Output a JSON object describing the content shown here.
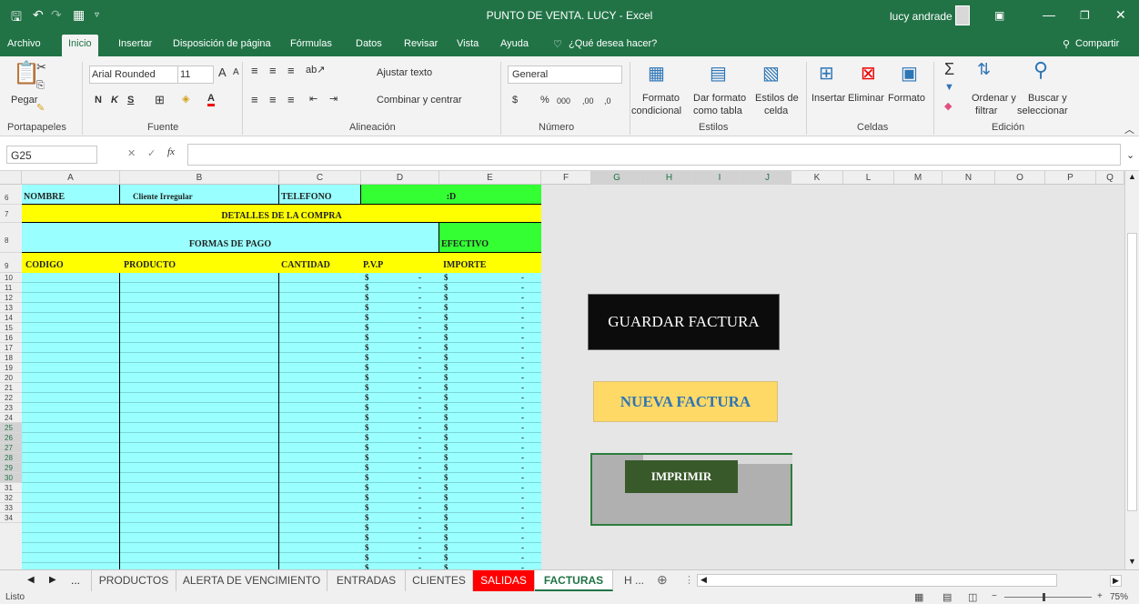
{
  "window": {
    "title": "PUNTO DE VENTA. LUCY  -  Excel",
    "user": "lucy andrade"
  },
  "menu": {
    "tabs": [
      "Archivo",
      "Inicio",
      "Insertar",
      "Disposición de página",
      "Fórmulas",
      "Datos",
      "Revisar",
      "Vista",
      "Ayuda"
    ],
    "tell_me": "¿Qué desea hacer?",
    "share": "Compartir"
  },
  "ribbon": {
    "paste": "Pegar",
    "font_name": "Arial Rounded",
    "font_size": "11",
    "font_increase": "A",
    "font_decrease": "A",
    "bold": "N",
    "italic": "K",
    "underline": "S",
    "font_color": "A",
    "wrap_text": "Ajustar texto",
    "merge_center": "Combinar y centrar",
    "number_format": "General",
    "currency": "$",
    "percent": "%",
    "thousands": "000",
    "dec_inc": ",00",
    "dec_dec": ",0",
    "cond_format": [
      "Formato",
      "condicional"
    ],
    "table_format": [
      "Dar formato",
      "como tabla"
    ],
    "cell_styles": [
      "Estilos de",
      "celda"
    ],
    "insert": "Insertar",
    "delete": "Eliminar",
    "format": "Formato",
    "sum": "Σ",
    "sort": [
      "Ordenar y",
      "filtrar"
    ],
    "find": [
      "Buscar y",
      "seleccionar"
    ],
    "groups": [
      "Portapapeles",
      "Fuente",
      "Alineación",
      "Número",
      "Estilos",
      "Celdas",
      "Edición"
    ]
  },
  "formula_bar": {
    "name_box": "G25",
    "fx": "fx",
    "value": ""
  },
  "columns": [
    "A",
    "B",
    "C",
    "D",
    "E",
    "F",
    "G",
    "H",
    "I",
    "J",
    "K",
    "L",
    "M",
    "N",
    "O",
    "P",
    "Q"
  ],
  "rows": [
    "6",
    "7",
    "8",
    "9",
    "10",
    "11",
    "12",
    "13",
    "14",
    "15",
    "16",
    "17",
    "18",
    "19",
    "20",
    "21",
    "22",
    "23",
    "24",
    "25",
    "26",
    "27",
    "28",
    "29",
    "30",
    "31",
    "32",
    "33",
    "34"
  ],
  "sheet": {
    "nombre_label": "NOMBRE",
    "nombre_value": "Cliente Irregular",
    "telefono_label": "TELEFONO",
    "telefono_value": ":D",
    "detalles": "DETALLES DE LA COMPRA",
    "formas_pago": "FORMAS DE PAGO",
    "efectivo": "EFECTIVO",
    "headers": [
      "CODIGO",
      "PRODUCTO",
      "CANTIDAD",
      "P.V.P",
      "IMPORTE"
    ],
    "dollar": "$",
    "dash": "-"
  },
  "buttons": {
    "guardar": "GUARDAR FACTURA",
    "nueva": "NUEVA FACTURA",
    "imprimir": "IMPRIMIR"
  },
  "sheet_tabs": {
    "more": "...",
    "tabs": [
      "PRODUCTOS",
      "ALERTA DE VENCIMIENTO",
      "ENTRADAS",
      "CLIENTES",
      "SALIDAS",
      "FACTURAS"
    ],
    "trailing": "H ...",
    "add": "⊕"
  },
  "status": {
    "ready": "Listo",
    "zoom": "75%"
  },
  "colors": {
    "excel_green": "#217346",
    "cyan": "#99ffff",
    "yellow": "#ffff00",
    "green": "#33ff33",
    "salidas_tab": "#ff0000"
  }
}
